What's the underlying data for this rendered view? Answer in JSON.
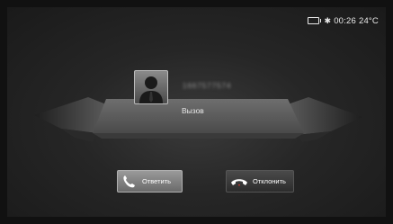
{
  "status_bar": {
    "battery_icon": "battery-icon",
    "bluetooth_icon": "bluetooth-icon",
    "time": "00:26",
    "temperature": "24°C"
  },
  "call": {
    "contact_avatar_icon": "person-silhouette-icon",
    "phone_number": "1667577574",
    "status": "Вызов"
  },
  "actions": {
    "answer_label": "Ответить",
    "answer_icon": "phone-answer-icon",
    "decline_label": "Отклонить",
    "decline_icon": "phone-hangup-icon"
  },
  "colors": {
    "answer_bg": "#8a8a8a",
    "decline_bg": "#3a3a3a",
    "text": "#e6e6e6"
  }
}
